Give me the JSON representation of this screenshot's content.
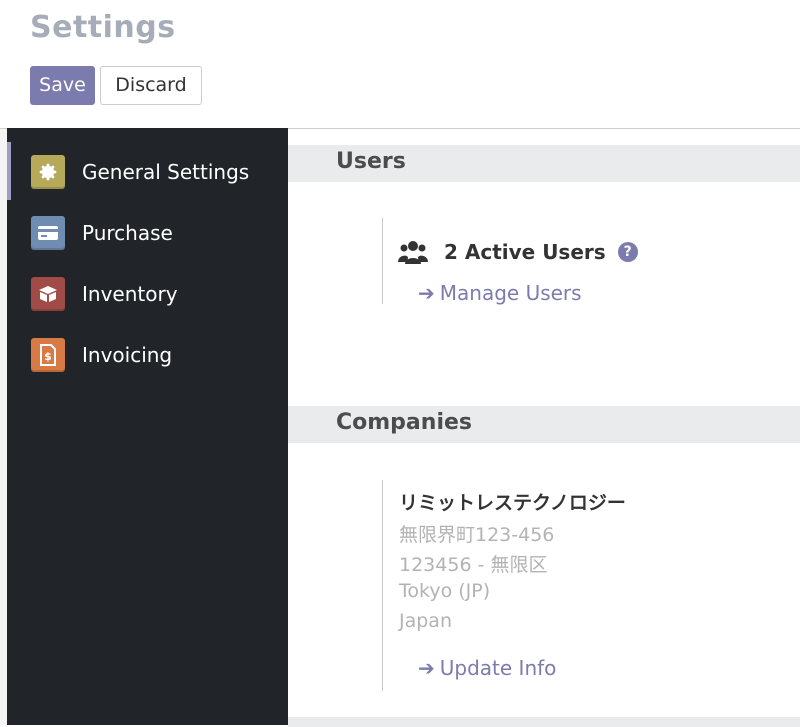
{
  "header": {
    "title": "Settings",
    "save_label": "Save",
    "discard_label": "Discard"
  },
  "sidebar": {
    "items": [
      {
        "label": "General Settings",
        "icon": "gear-icon",
        "color": "#b7a95a",
        "active": true
      },
      {
        "label": "Purchase",
        "icon": "credit-card-icon",
        "color": "#6f8db0",
        "active": false
      },
      {
        "label": "Inventory",
        "icon": "box-icon",
        "color": "#a14b47",
        "active": false
      },
      {
        "label": "Invoicing",
        "icon": "invoice-dollar-icon",
        "color": "#d77a45",
        "active": false
      }
    ]
  },
  "sections": {
    "users": {
      "title": "Users",
      "active_users": "2 Active Users",
      "help_glyph": "?",
      "manage_link": "Manage Users"
    },
    "companies": {
      "title": "Companies",
      "company_name": "リミットレステクノロジー",
      "address_lines": [
        "無限界町123-456",
        "123456 - 無限区",
        "Tokyo (JP)",
        "Japan"
      ],
      "update_link": "Update Info"
    }
  },
  "colors": {
    "accent": "#7c7bad",
    "sidebar_bg": "#212428",
    "section_bg": "#e9ebed"
  }
}
